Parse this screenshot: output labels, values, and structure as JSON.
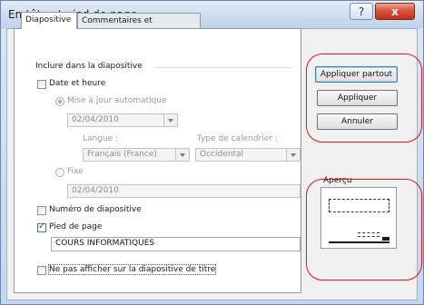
{
  "window": {
    "title": "En-tête et pied de page",
    "help_label": "?",
    "close_label": "x"
  },
  "tabs": [
    {
      "label": "Diapositive",
      "active": true
    },
    {
      "label": "Commentaires et documents",
      "active": false
    }
  ],
  "include_group": {
    "label": "Inclure dans la diapositive",
    "date_time": {
      "label": "Date et heure",
      "checked": false
    },
    "auto_update": {
      "label": "Mise à jour automatique",
      "selected": true,
      "value": "02/04/2010"
    },
    "language": {
      "label": "Langue :",
      "value": "Français (France)"
    },
    "calendar": {
      "label": "Type de calendrier :",
      "value": "Occidental"
    },
    "fixed": {
      "label": "Fixe",
      "selected": false,
      "value": "02/04/2010"
    },
    "slide_number": {
      "label": "Numéro de diapositive",
      "checked": false
    },
    "footer": {
      "label": "Pied de page",
      "checked": true,
      "value": "COURS INFORMATIQUES"
    }
  },
  "dont_show_title": {
    "label": "Ne pas afficher sur la diapositive de titre",
    "checked": false
  },
  "buttons": {
    "apply_all": "Appliquer partout",
    "apply": "Appliquer",
    "cancel": "Annuler"
  },
  "preview": {
    "label": "Aperçu"
  },
  "colors": {
    "annotation": "#e01515",
    "close": "#c2301a"
  }
}
